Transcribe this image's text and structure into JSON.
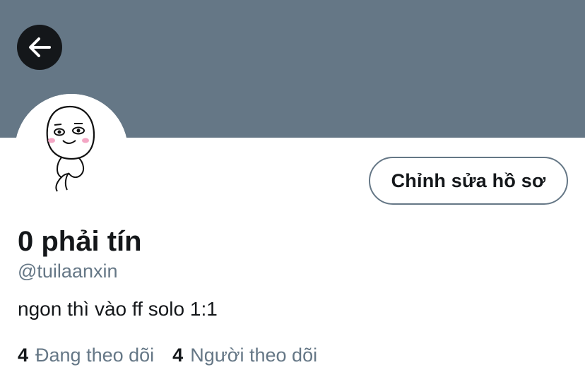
{
  "header": {
    "back_icon": "arrow-left-icon"
  },
  "profile": {
    "display_name": "0 phải tín",
    "handle": "@tuilaanxin",
    "bio": "ngon thì vào ff solo 1:1",
    "edit_button_label": "Chỉnh sửa hồ sơ"
  },
  "stats": {
    "following_count": "4",
    "following_label": "Đang theo dõi",
    "followers_count": "4",
    "followers_label": "Người theo dõi"
  },
  "colors": {
    "banner": "#657786",
    "text_primary": "#14171a",
    "text_secondary": "#657786"
  }
}
